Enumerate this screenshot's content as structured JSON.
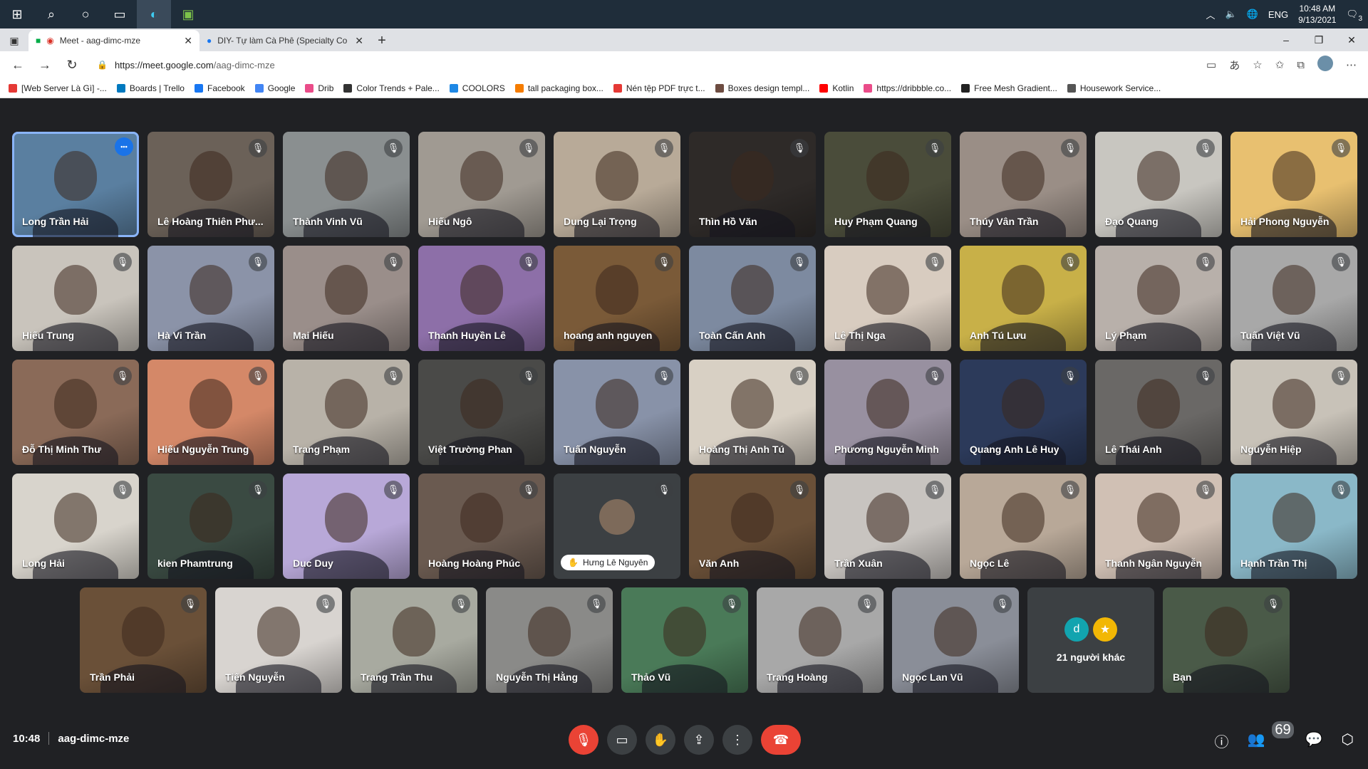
{
  "taskbar": {
    "lang": "ENG",
    "time": "10:48 AM",
    "date": "9/13/2021",
    "notification_count": "3"
  },
  "browser": {
    "tabs": [
      {
        "title": "Meet - aag-dimc-mze",
        "active": true
      },
      {
        "title": "DIY- Tự làm Cà Phê (Specialty Co",
        "active": false
      }
    ],
    "url_domain": "https://meet.google.com",
    "url_path": "/aag-dimc-mze",
    "bookmarks": [
      {
        "label": "[Web Server Là Gì] -...",
        "color": "#e53935"
      },
      {
        "label": "Boards | Trello",
        "color": "#0079bf"
      },
      {
        "label": "Facebook",
        "color": "#1877f2"
      },
      {
        "label": "Google",
        "color": "#4285f4"
      },
      {
        "label": "Drib",
        "color": "#ea4c89"
      },
      {
        "label": "Color Trends + Pale...",
        "color": "#333333"
      },
      {
        "label": "COOLORS",
        "color": "#1e88e5"
      },
      {
        "label": "tall packaging box...",
        "color": "#f57c00"
      },
      {
        "label": "Nén tệp PDF trực t...",
        "color": "#e53935"
      },
      {
        "label": "Boxes design templ...",
        "color": "#6d4c41"
      },
      {
        "label": "Kotlin",
        "color": "#ff0000"
      },
      {
        "label": "https://dribbble.co...",
        "color": "#ea4c89"
      },
      {
        "label": "Free Mesh Gradient...",
        "color": "#222222"
      },
      {
        "label": "Housework Service...",
        "color": "#555555"
      }
    ]
  },
  "participants": [
    [
      {
        "name": "Long Trần Hải",
        "bg": "#5a7fa0",
        "pinned": true
      },
      {
        "name": "Lê Hoàng Thiên Phư...",
        "bg": "#6b6158"
      },
      {
        "name": "Thành Vinh Vũ",
        "bg": "#8a8f90"
      },
      {
        "name": "Hiếu Ngô",
        "bg": "#a09a92"
      },
      {
        "name": "Dung Lại Trọng",
        "bg": "#b8aa98"
      },
      {
        "name": "Thìn Hồ Văn",
        "bg": "#2e2a28"
      },
      {
        "name": "Huy Phạm Quang",
        "bg": "#4a4c3a"
      },
      {
        "name": "Thúy Vân Trần",
        "bg": "#9a8e86"
      },
      {
        "name": "Đạo Quang",
        "bg": "#c8c6c0"
      },
      {
        "name": "Hải Phong Nguyễn",
        "bg": "#e8c070"
      }
    ],
    [
      {
        "name": "Hiếu Trung",
        "bg": "#c9c4bc"
      },
      {
        "name": "Hà Vi Trần",
        "bg": "#8b93a8"
      },
      {
        "name": "Mai Hiếu",
        "bg": "#9a8e8a"
      },
      {
        "name": "Thanh Huyền Lê",
        "bg": "#8d6fa8"
      },
      {
        "name": "hoang anh nguyen",
        "bg": "#7a5a38"
      },
      {
        "name": "Toàn Cấn Anh",
        "bg": "#7d8aa0"
      },
      {
        "name": "Lê Thị Nga",
        "bg": "#d8ccc0"
      },
      {
        "name": "Anh Tú Lưu",
        "bg": "#c8b048"
      },
      {
        "name": "Lý Phạm",
        "bg": "#b8b0aa"
      },
      {
        "name": "Tuấn Việt Vũ",
        "bg": "#a8a8a8"
      }
    ],
    [
      {
        "name": "Đỗ Thị Minh Thư",
        "bg": "#8a6a58"
      },
      {
        "name": "Hiếu Nguyễn Trung",
        "bg": "#d48868"
      },
      {
        "name": "Trang Phạm",
        "bg": "#b8b2a8"
      },
      {
        "name": "Việt Trường Phan",
        "bg": "#4a4a48"
      },
      {
        "name": "Tuấn Nguyễn",
        "bg": "#8892a8"
      },
      {
        "name": "Hoàng Thị Anh Tú",
        "bg": "#d8d0c4"
      },
      {
        "name": "Phương Nguyễn Minh",
        "bg": "#9890a0"
      },
      {
        "name": "Quang Anh Lê Huy",
        "bg": "#2c3a5a"
      },
      {
        "name": "Lê Thái Anh",
        "bg": "#6a6866"
      },
      {
        "name": "Nguyễn Hiệp",
        "bg": "#c8c2b8"
      }
    ],
    [
      {
        "name": "Long Hải",
        "bg": "#d8d4cc"
      },
      {
        "name": "kien Phamtrung",
        "bg": "#3a4a42"
      },
      {
        "name": "Duc Duy",
        "bg": "#b8a8d8"
      },
      {
        "name": "Hoàng Hoàng Phúc",
        "bg": "#6a5a50"
      },
      {
        "name": "Hưng Lê Nguyên",
        "bg": "#3c4043",
        "placeholder": true
      },
      {
        "name": "Văn Anh",
        "bg": "#6a5038"
      },
      {
        "name": "Trần Xuân",
        "bg": "#c8c4c0"
      },
      {
        "name": "Ngọc Lê",
        "bg": "#b8a898"
      },
      {
        "name": "Thanh Ngân Nguyễn",
        "bg": "#d0c0b4"
      },
      {
        "name": "Hạnh Trần Thị",
        "bg": "#8ab8c8"
      }
    ],
    [
      {
        "name": "Trần Phải",
        "bg": "#6a5038"
      },
      {
        "name": "Tiến Nguyễn",
        "bg": "#d8d4d0"
      },
      {
        "name": "Trang Trần Thu",
        "bg": "#a8aaa0"
      },
      {
        "name": "Nguyễn Thị Hằng",
        "bg": "#8a8a88"
      },
      {
        "name": "Thảo Vũ",
        "bg": "#4a7a58"
      },
      {
        "name": "Trang Hoàng",
        "bg": "#a8a8a8"
      },
      {
        "name": "Ngọc Lan Vũ",
        "bg": "#8a8e98"
      },
      {
        "name": "21 người khác",
        "others": true
      },
      {
        "name": "Bạn",
        "bg": "#4a5a48"
      }
    ]
  ],
  "others_avatars": [
    {
      "letter": "d",
      "color": "#12a4af"
    },
    {
      "letter": "★",
      "color": "#f2b705"
    }
  ],
  "meeting": {
    "time": "10:48",
    "code": "aag-dimc-mze",
    "participant_count": "69"
  },
  "colors": {
    "accent": "#8ab4f8",
    "end_call": "#ea4335",
    "bg": "#202124"
  }
}
